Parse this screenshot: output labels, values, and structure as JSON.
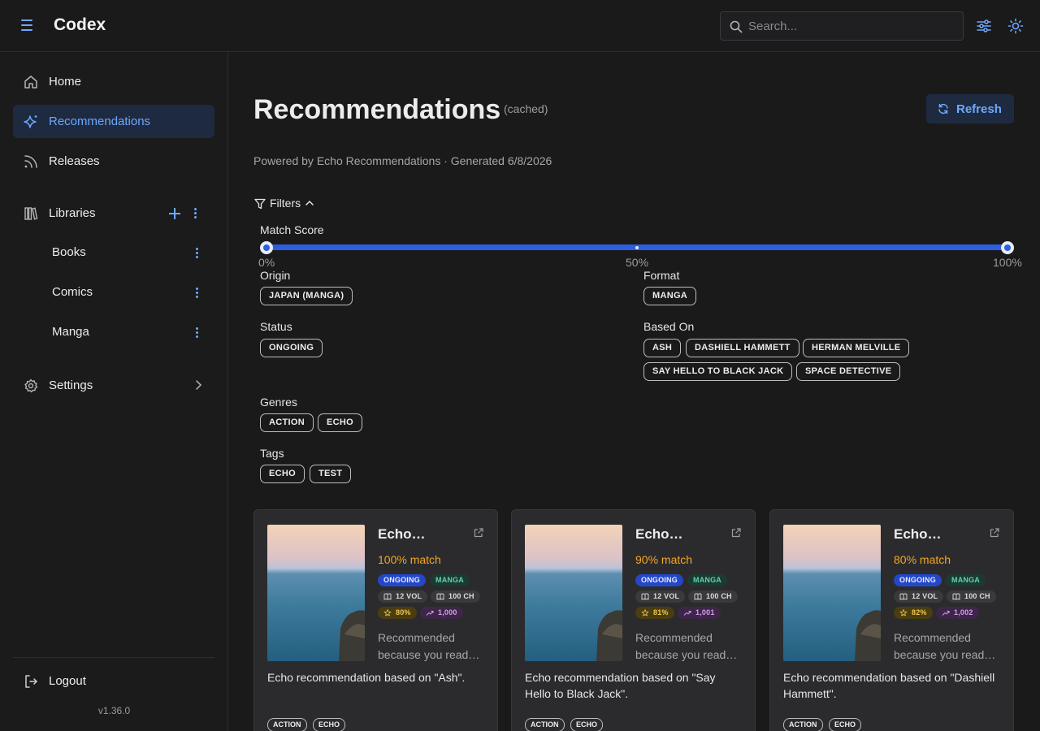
{
  "app": {
    "title": "Codex",
    "version": "v1.36.0"
  },
  "search": {
    "placeholder": "Search..."
  },
  "sidebar": {
    "home": "Home",
    "recommendations": "Recommendations",
    "releases": "Releases",
    "libraries": "Libraries",
    "library_items": [
      "Books",
      "Comics",
      "Manga"
    ],
    "settings": "Settings",
    "logout": "Logout"
  },
  "page": {
    "title": "Recommendations",
    "cached": "(cached)",
    "refresh": "Refresh",
    "powered_by": "Powered by Echo Recommendations · Generated 6/8/2026"
  },
  "filters": {
    "toggle": "Filters",
    "match_score": {
      "label": "Match Score",
      "min_label": "0%",
      "mid_label": "50%",
      "max_label": "100%",
      "range": [
        0,
        100
      ]
    },
    "origin": {
      "label": "Origin",
      "options": [
        "JAPAN (MANGA)"
      ]
    },
    "format": {
      "label": "Format",
      "options": [
        "MANGA"
      ]
    },
    "status": {
      "label": "Status",
      "options": [
        "ONGOING"
      ]
    },
    "based_on": {
      "label": "Based On",
      "options": [
        "ASH",
        "DASHIELL HAMMETT",
        "HERMAN MELVILLE",
        "SAY HELLO TO BLACK JACK",
        "SPACE DETECTIVE"
      ]
    },
    "genres": {
      "label": "Genres",
      "options": [
        "ACTION",
        "ECHO"
      ]
    },
    "tags": {
      "label": "Tags",
      "options": [
        "ECHO",
        "TEST"
      ]
    }
  },
  "cards": [
    {
      "title": "Echo…",
      "match": "100% match",
      "status": "ONGOING",
      "format": "MANGA",
      "volumes": "12 VOL",
      "chapters": "100 CH",
      "rating": "80%",
      "popularity": "1,000",
      "reason_line1": "Recommended",
      "reason_line2": "because you read…",
      "description": "Echo recommendation based on \"Ash\".",
      "genres": [
        "ACTION",
        "ECHO"
      ]
    },
    {
      "title": "Echo…",
      "match": "90% match",
      "status": "ONGOING",
      "format": "MANGA",
      "volumes": "12 VOL",
      "chapters": "100 CH",
      "rating": "81%",
      "popularity": "1,001",
      "reason_line1": "Recommended",
      "reason_line2": "because you read…",
      "description": "Echo recommendation based on \"Say Hello to Black Jack\".",
      "genres": [
        "ACTION",
        "ECHO"
      ]
    },
    {
      "title": "Echo…",
      "match": "80% match",
      "status": "ONGOING",
      "format": "MANGA",
      "volumes": "12 VOL",
      "chapters": "100 CH",
      "rating": "82%",
      "popularity": "1,002",
      "reason_line1": "Recommended",
      "reason_line2": "because you read…",
      "description": "Echo recommendation based on \"Dashiell Hammett\".",
      "genres": [
        "ACTION",
        "ECHO"
      ]
    }
  ],
  "colors": {
    "accent": "#6ea8fe",
    "slider": "#2c5ee0",
    "match": "#f6a623",
    "background": "#1a1a1b",
    "card": "#2b2b2d"
  }
}
